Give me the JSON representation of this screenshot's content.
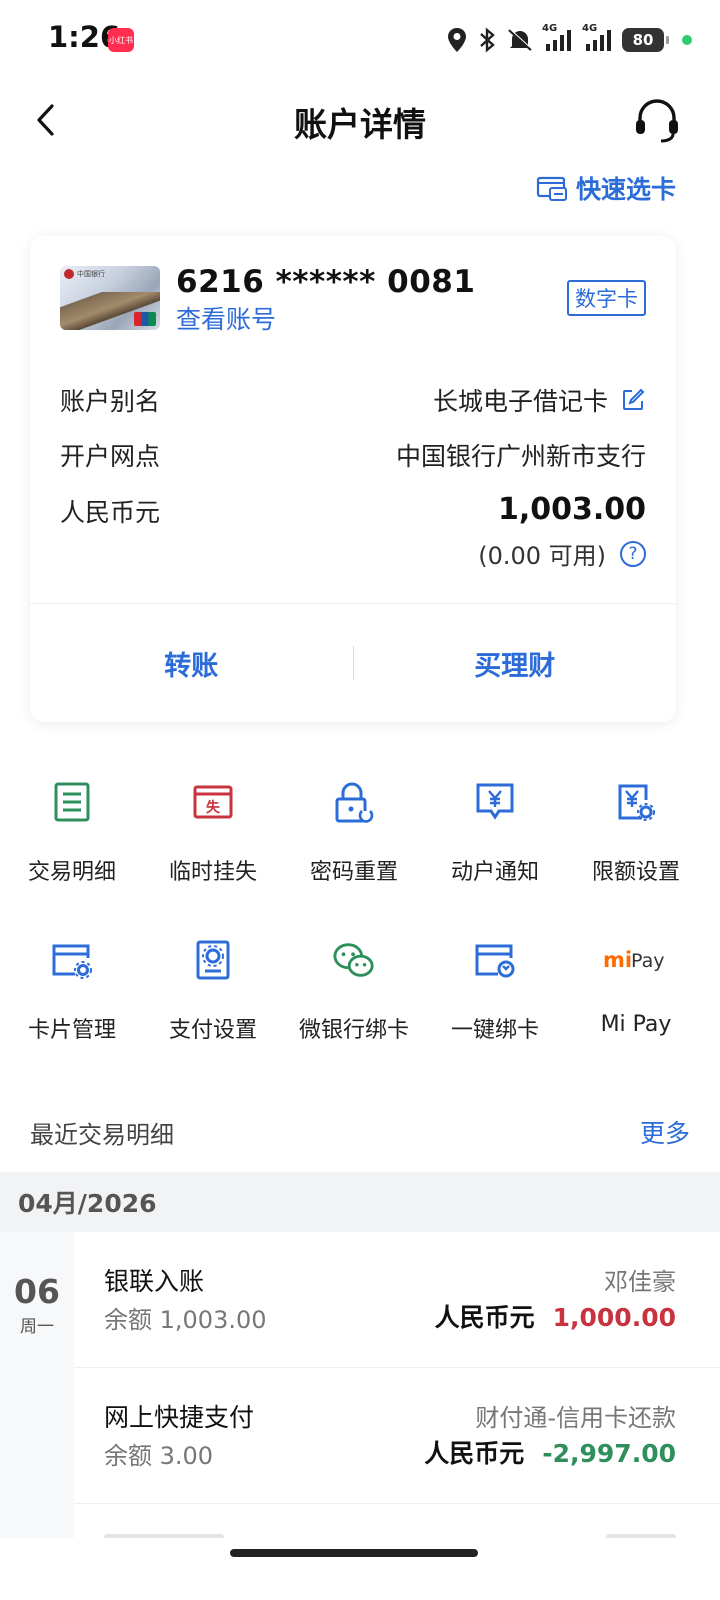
{
  "status": {
    "time": "1:26",
    "app_badge": "小红书",
    "net1": "4G",
    "net2": "4G",
    "battery": "80",
    "indicator_color": "#2ecc71"
  },
  "header": {
    "title": "账户详情",
    "back_icon": "chevron-left-icon",
    "service_icon": "headset-icon"
  },
  "quick_select": {
    "label": "快速选卡",
    "icon": "card-switch-icon"
  },
  "account_card": {
    "card_number": "6216 ****** 0081",
    "view_account": "查看账号",
    "badge": "数字卡",
    "rows": [
      {
        "label": "账户别名",
        "value": "长城电子借记卡"
      },
      {
        "label": "开户网点",
        "value": "中国银行广州新市支行"
      },
      {
        "label": "人民币元"
      }
    ],
    "balance": "1,003.00",
    "available": "(0.00 可用)",
    "help_icon": "?",
    "actions": [
      "转账",
      "买理财"
    ]
  },
  "services": [
    {
      "label": "交易明细",
      "icon": "list-icon",
      "color": "#2f8f5c"
    },
    {
      "label": "临时挂失",
      "icon": "report-loss-icon",
      "color": "#c8333f",
      "glyph": "失"
    },
    {
      "label": "密码重置",
      "icon": "lock-reset-icon",
      "color": "#2c6cd8"
    },
    {
      "label": "动户通知",
      "icon": "yuan-message-icon",
      "color": "#2c6cd8"
    },
    {
      "label": "限额设置",
      "icon": "limit-settings-icon",
      "color": "#2c6cd8"
    },
    {
      "label": "卡片管理",
      "icon": "card-settings-icon",
      "color": "#2c6cd8"
    },
    {
      "label": "支付设置",
      "icon": "payment-settings-icon",
      "color": "#2c6cd8"
    },
    {
      "label": "微银行绑卡",
      "icon": "wechat-icon",
      "color": "#2f8f5c"
    },
    {
      "label": "一键绑卡",
      "icon": "bind-card-icon",
      "color": "#2c6cd8"
    },
    {
      "label": "Mi Pay",
      "icon": "mi-pay-logo",
      "logo_text": "Pay",
      "logo_mi": "mi",
      "color": "#ff6900"
    }
  ],
  "recent": {
    "title": "最近交易明细",
    "more": "更多",
    "month": "04月/2026",
    "day": "06",
    "weekday": "周一",
    "transactions": [
      {
        "name": "银联入账",
        "balance": "余额 1,003.00",
        "counterparty": "邓佳豪",
        "currency": "人民币元",
        "amount": "1,000.00"
      },
      {
        "name": "网上快捷支付",
        "balance": "余额 3.00",
        "counterparty": "财付通-信用卡还款",
        "currency": "人民币元",
        "amount": "-2,997.00"
      }
    ]
  }
}
